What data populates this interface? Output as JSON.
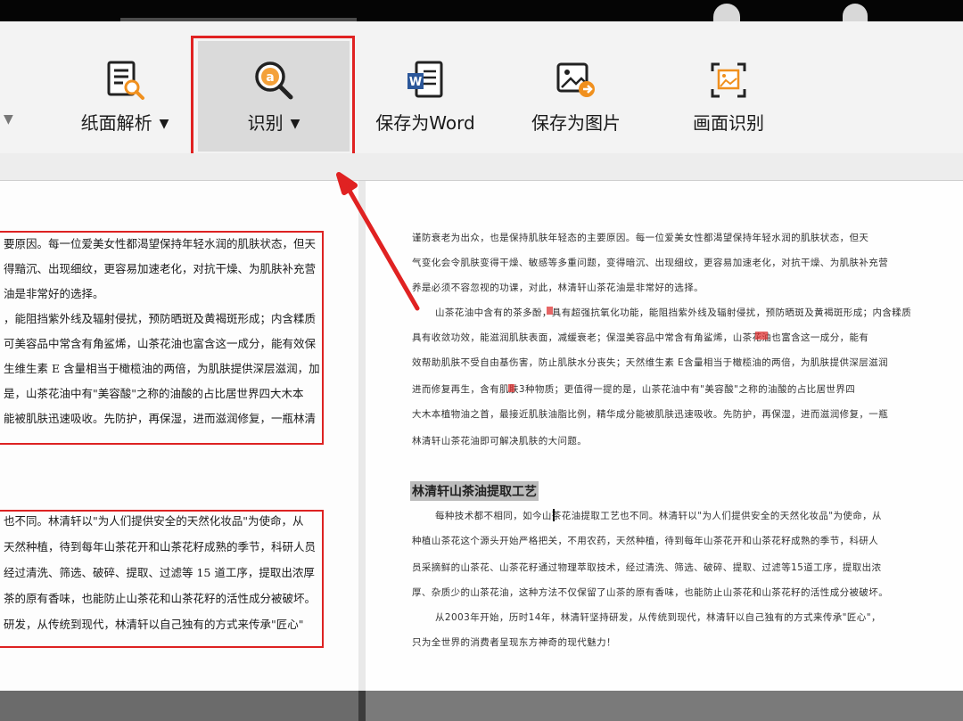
{
  "toolbar": {
    "paper_analysis": {
      "label": "纸面解析",
      "caret": "▼",
      "icon": "doc-magnifier-icon"
    },
    "recognize": {
      "label": "识别",
      "caret": "▼",
      "icon": "text-magnifier-icon"
    },
    "save_word": {
      "label": "保存为Word",
      "icon": "word-doc-icon"
    },
    "save_image": {
      "label": "保存为图片",
      "icon": "image-export-icon"
    },
    "screen_recognize": {
      "label": "画面识别",
      "icon": "screen-capture-icon"
    },
    "left_caret": "▼"
  },
  "colors": {
    "highlight": "#e02222",
    "selected_button_bg": "#dadada",
    "word_blue": "#2b579a",
    "accent_orange": "#f0901e"
  },
  "left_scan": {
    "block1": [
      "要原因。每一位爱美女性都渴望保持年轻水润的肌肤状态，但天",
      "得黯沉、出现细纹，更容易加速老化，对抗干燥、为肌肤补充营",
      "油是非常好的选择。",
      "，能阻挡紫外线及辐射侵扰，预防晒斑及黄褐斑形成；内含糅质",
      "可美容品中常含有角鲨烯，山茶花油也富含这一成分，能有效保",
      "生维生素 E 含量相当于橄榄油的两倍，为肌肤提供深层滋润，加",
      "是，山茶花油中有\"美容酸\"之称的油酸的占比居世界四大木本",
      "能被肌肤迅速吸收。先防护，再保湿，进而滋润修复，一瓶林清"
    ],
    "block2": [
      "也不同。林清轩以\"为人们提供安全的天然化妆品\"为使命，从",
      "天然种植，待到每年山茶花开和山茶花籽成熟的季节，科研人员",
      "经过清洗、筛选、破碎、提取、过滤等 15 道工序，提取出浓厚",
      "茶的原有香味，也能防止山茶花和山茶花籽的活性成分被破坏。",
      "研发，从传统到现代，林清轩以自己独有的方式来传承\"匠心\""
    ]
  },
  "right_ocr": {
    "para1": [
      "谨防衰老为出众，也是保持肌肤年轻态的主要原因。每一位爱美女性都渴望保持年轻水润的肌肤状态，但天",
      "气变化会令肌肤变得干燥、敏感等多重问题，变得暗沉、出现细纹，更容易加速老化，对抗干燥、为肌肤补充营",
      "养是必须不容忽视的功课，对此，林清轩山茶花油是非常好的选择。"
    ],
    "para2": [
      "山茶花油中含有的茶多酚，具有超强抗氧化功能，能阻挡紫外线及辐射侵扰，预防晒斑及黄褐斑形成；内含糅质",
      "具有收敛功效，能滋润肌肤表面，减缓衰老；保湿美容品中常含有角鲨烯，山茶花油也富含这一成分，能有",
      "效帮助肌肤不受自由基伤害，防止肌肤水分丧失；天然维生素 E含量相当于橄榄油的两倍，为肌肤提供深层滋润",
      "进而修复再生，含有肌肤3种物质；更值得一提的是，山茶花油中有\"美容酸\"之称的油酸的占比居世界四",
      "大木本植物油之首，最接近肌肤油脂比例，精华成分能被肌肤迅速吸收。先防护，再保湿，进而滋润修复，一瓶",
      "林清轩山茶花油即可解决肌肤的大问题。"
    ],
    "heading": "林清轩山茶油提取工艺",
    "para3": [
      "每种技术都不相同，如今山茶花油提取工艺也不同。林清轩以\"为人们提供安全的天然化妆品\"为使命，从",
      "种植山茶花这个源头开始严格把关，不用农药，天然种植，待到每年山茶花开和山茶花籽成熟的季节，科研人",
      "员采摘鲜的山茶花、山茶花籽通过物理萃取技术，经过清洗、筛选、破碎、提取、过滤等15道工序，提取出浓",
      "厚、杂质少的山茶花油，这种方法不仅保留了山茶的原有香味，也能防止山茶花和山茶花籽的活性成分被破坏。"
    ],
    "para4": [
      "从2003年开始，历时14年，林清轩坚持研发，从传统到现代，林清轩以自己独有的方式来传承\"匠心\"，",
      "只为全世界的消费者呈现东方神奇的现代魅力！"
    ]
  }
}
